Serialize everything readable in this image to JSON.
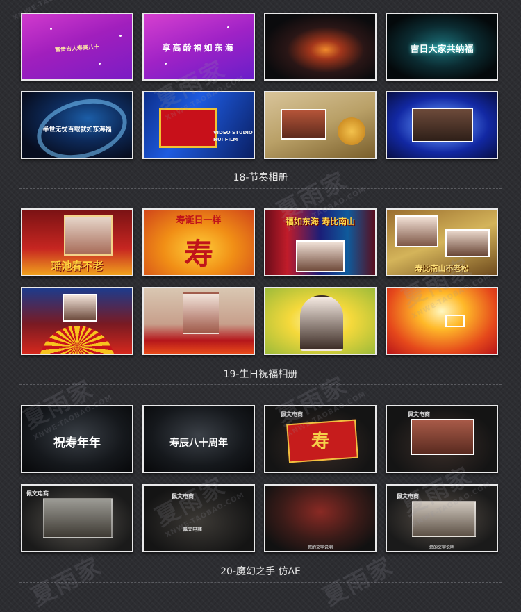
{
  "sections": [
    {
      "title": "18-节奏相册"
    },
    {
      "title": "19-生日祝福相册"
    },
    {
      "title": "20-魔幻之手 仿AE"
    }
  ],
  "captions": {
    "s18_1": "富贵吉人寿高八十",
    "s18_2": "享高龄福如东海",
    "s18_4": "吉日大家共纳福",
    "s18_5": "半世无忧百载就如东海福",
    "s18_6a": "VIDEO STUDIO",
    "s18_6b": "HUI FILM",
    "s19_1": "瑶池春不老",
    "s19_2a": "寿诞日一样",
    "s19_2b": "寿",
    "s19_3": "福如东海 寿比南山",
    "s19_4": "寿比南山不老松",
    "s20_1": "祝寿年年",
    "s20_2": "寿辰八十周年",
    "s20_brand": "佩文电商",
    "s20_seal": "寿",
    "s20_sub": "您的文字说明"
  },
  "watermark": {
    "main": "夏雨家",
    "sub": "XNWE-TAOBAO.COM"
  },
  "colors": {
    "background": "#2c2d31",
    "frame": "#e9e9ea",
    "title_text": "#e6e6e6"
  }
}
